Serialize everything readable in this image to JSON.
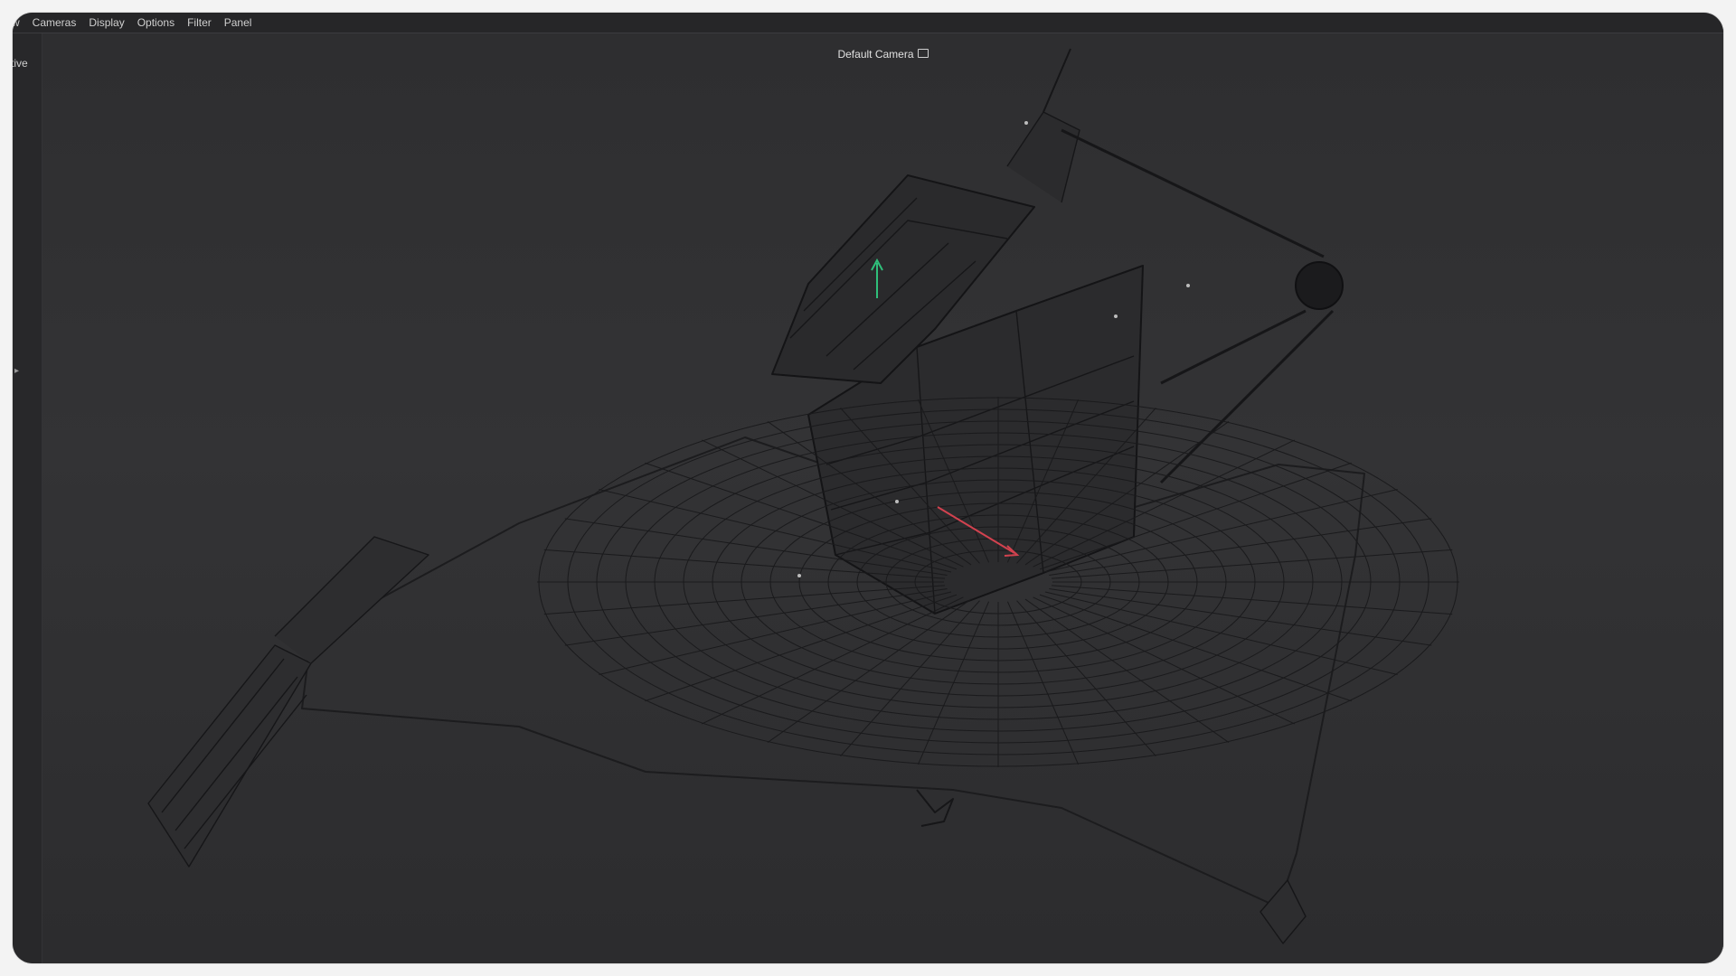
{
  "menubar": {
    "items": [
      {
        "label": "w"
      },
      {
        "label": "Cameras"
      },
      {
        "label": "Display"
      },
      {
        "label": "Options"
      },
      {
        "label": "Filter"
      },
      {
        "label": "Panel"
      }
    ]
  },
  "viewport": {
    "view_label": "ctive",
    "camera_title": "Default Camera",
    "camera_icon": "camera-icon"
  },
  "colors": {
    "background": "#2f2f31",
    "menubar": "#262628",
    "wire": "#161618",
    "y_axis": "#2fbf7a",
    "x_axis": "#d2424f"
  }
}
